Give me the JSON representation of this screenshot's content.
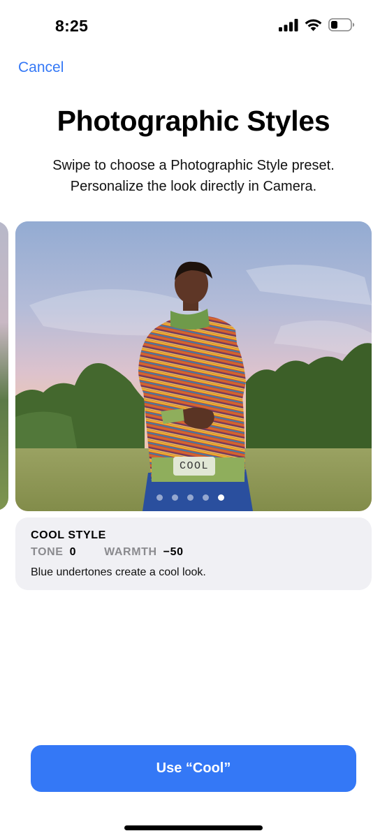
{
  "status_bar": {
    "time": "8:25",
    "icons": [
      "cellular-signal-icon",
      "wifi-icon",
      "battery-icon"
    ]
  },
  "nav": {
    "cancel_label": "Cancel"
  },
  "header": {
    "title": "Photographic Styles",
    "subtitle_line1": "Swipe to choose a Photographic Style preset.",
    "subtitle_line2": "Personalize the look directly in Camera."
  },
  "carousel": {
    "badge_label": "COOL",
    "page_count": 5,
    "active_page": 5
  },
  "style_info": {
    "name": "COOL STYLE",
    "tone_label": "TONE",
    "tone_value": "0",
    "warmth_label": "WARMTH",
    "warmth_value": "−50",
    "description": "Blue undertones create a cool look."
  },
  "action": {
    "button_label": "Use “Cool”"
  },
  "colors": {
    "accent": "#3478f6",
    "card_background": "#f0f0f4",
    "secondary_text": "#8a8a8e"
  }
}
